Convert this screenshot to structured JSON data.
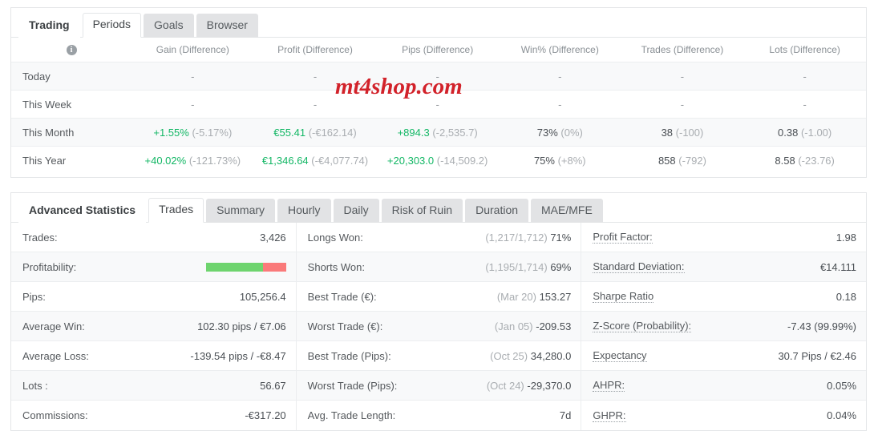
{
  "colors": {
    "positive": "#13b765",
    "muted": "#a9adb1",
    "bar_win": "#6ed46e",
    "bar_loss": "#fa7a7a",
    "watermark": "#d2222a"
  },
  "watermark": {
    "text": "mt4shop.com"
  },
  "periods_panel": {
    "tabs": [
      {
        "label": "Trading",
        "state": "bold"
      },
      {
        "label": "Periods",
        "state": "active"
      },
      {
        "label": "Goals",
        "state": "inactive"
      },
      {
        "label": "Browser",
        "state": "inactive"
      }
    ],
    "info_icon": "info-icon",
    "columns": [
      "",
      "Gain (Difference)",
      "Profit (Difference)",
      "Pips (Difference)",
      "Win% (Difference)",
      "Trades (Difference)",
      "Lots (Difference)"
    ],
    "rows": [
      {
        "label": "Today",
        "cells": [
          {
            "main": "-",
            "diff": "",
            "style": "dash"
          },
          {
            "main": "-",
            "diff": "",
            "style": "dash"
          },
          {
            "main": "-",
            "diff": "",
            "style": "dash"
          },
          {
            "main": "-",
            "diff": "",
            "style": "dash"
          },
          {
            "main": "-",
            "diff": "",
            "style": "dash"
          },
          {
            "main": "-",
            "diff": "",
            "style": "dash"
          }
        ]
      },
      {
        "label": "This Week",
        "cells": [
          {
            "main": "-",
            "diff": "",
            "style": "dash"
          },
          {
            "main": "-",
            "diff": "",
            "style": "dash"
          },
          {
            "main": "-",
            "diff": "",
            "style": "dash"
          },
          {
            "main": "-",
            "diff": "",
            "style": "dash"
          },
          {
            "main": "-",
            "diff": "",
            "style": "dash"
          },
          {
            "main": "-",
            "diff": "",
            "style": "dash"
          }
        ]
      },
      {
        "label": "This Month",
        "cells": [
          {
            "main": "+1.55%",
            "diff": "(-5.17%)",
            "style": "pos"
          },
          {
            "main": "€55.41",
            "diff": "(-€162.14)",
            "style": "pos"
          },
          {
            "main": "+894.3",
            "diff": "(-2,535.7)",
            "style": "pos"
          },
          {
            "main": "73%",
            "diff": "(0%)",
            "style": "neutral"
          },
          {
            "main": "38",
            "diff": "(-100)",
            "style": "neutral"
          },
          {
            "main": "0.38",
            "diff": "(-1.00)",
            "style": "neutral"
          }
        ]
      },
      {
        "label": "This Year",
        "cells": [
          {
            "main": "+40.02%",
            "diff": "(-121.73%)",
            "style": "pos"
          },
          {
            "main": "€1,346.64",
            "diff": "(-€4,077.74)",
            "style": "pos"
          },
          {
            "main": "+20,303.0",
            "diff": "(-14,509.2)",
            "style": "pos"
          },
          {
            "main": "75%",
            "diff": "(+8%)",
            "style": "neutral"
          },
          {
            "main": "858",
            "diff": "(-792)",
            "style": "neutral"
          },
          {
            "main": "8.58",
            "diff": "(-23.76)",
            "style": "neutral"
          }
        ]
      }
    ]
  },
  "stats_panel": {
    "tabs": [
      {
        "label": "Advanced Statistics",
        "state": "bold"
      },
      {
        "label": "Trades",
        "state": "active"
      },
      {
        "label": "Summary",
        "state": "inactive"
      },
      {
        "label": "Hourly",
        "state": "inactive"
      },
      {
        "label": "Daily",
        "state": "inactive"
      },
      {
        "label": "Risk of Ruin",
        "state": "inactive"
      },
      {
        "label": "Duration",
        "state": "inactive"
      },
      {
        "label": "MAE/MFE",
        "state": "inactive"
      }
    ],
    "col1": [
      {
        "label": "Trades:",
        "value": "3,426",
        "type": "text"
      },
      {
        "label": "Profitability:",
        "value": "",
        "type": "bar",
        "win_pct": 71,
        "loss_pct": 29
      },
      {
        "label": "Pips:",
        "value": "105,256.4",
        "type": "text"
      },
      {
        "label": "Average Win:",
        "value": "102.30 pips / €7.06",
        "type": "text"
      },
      {
        "label": "Average Loss:",
        "value": "-139.54 pips / -€8.47",
        "type": "text"
      },
      {
        "label": "Lots :",
        "value": "56.67",
        "type": "text"
      },
      {
        "label": "Commissions:",
        "value": "-€317.20",
        "type": "text"
      }
    ],
    "col2": [
      {
        "label": "Longs Won:",
        "prefix": "(1,217/1,712)",
        "value": "71%",
        "type": "prefix"
      },
      {
        "label": "Shorts Won:",
        "prefix": "(1,195/1,714)",
        "value": "69%",
        "type": "prefix"
      },
      {
        "label": "Best Trade (€):",
        "prefix": "(Mar 20)",
        "value": "153.27",
        "type": "prefix"
      },
      {
        "label": "Worst Trade (€):",
        "prefix": "(Jan 05)",
        "value": "-209.53",
        "type": "prefix"
      },
      {
        "label": "Best Trade (Pips):",
        "prefix": "(Oct 25)",
        "value": "34,280.0",
        "type": "prefix"
      },
      {
        "label": "Worst Trade (Pips):",
        "prefix": "(Oct 24)",
        "value": "-29,370.0",
        "type": "prefix"
      },
      {
        "label": "Avg. Trade Length:",
        "prefix": "",
        "value": "7d",
        "type": "prefix"
      }
    ],
    "col3": [
      {
        "label": "Profit Factor:",
        "value": "1.98",
        "tip": true
      },
      {
        "label": "Standard Deviation:",
        "value": "€14.111",
        "tip": true
      },
      {
        "label": "Sharpe Ratio",
        "value": "0.18",
        "tip": true
      },
      {
        "label": "Z-Score (Probability):",
        "value": "-7.43 (99.99%)",
        "tip": true
      },
      {
        "label": "Expectancy",
        "value": "30.7 Pips / €2.46",
        "tip": true
      },
      {
        "label": "AHPR:",
        "value": "0.05%",
        "tip": true
      },
      {
        "label": "GHPR:",
        "value": "0.04%",
        "tip": true
      }
    ]
  }
}
